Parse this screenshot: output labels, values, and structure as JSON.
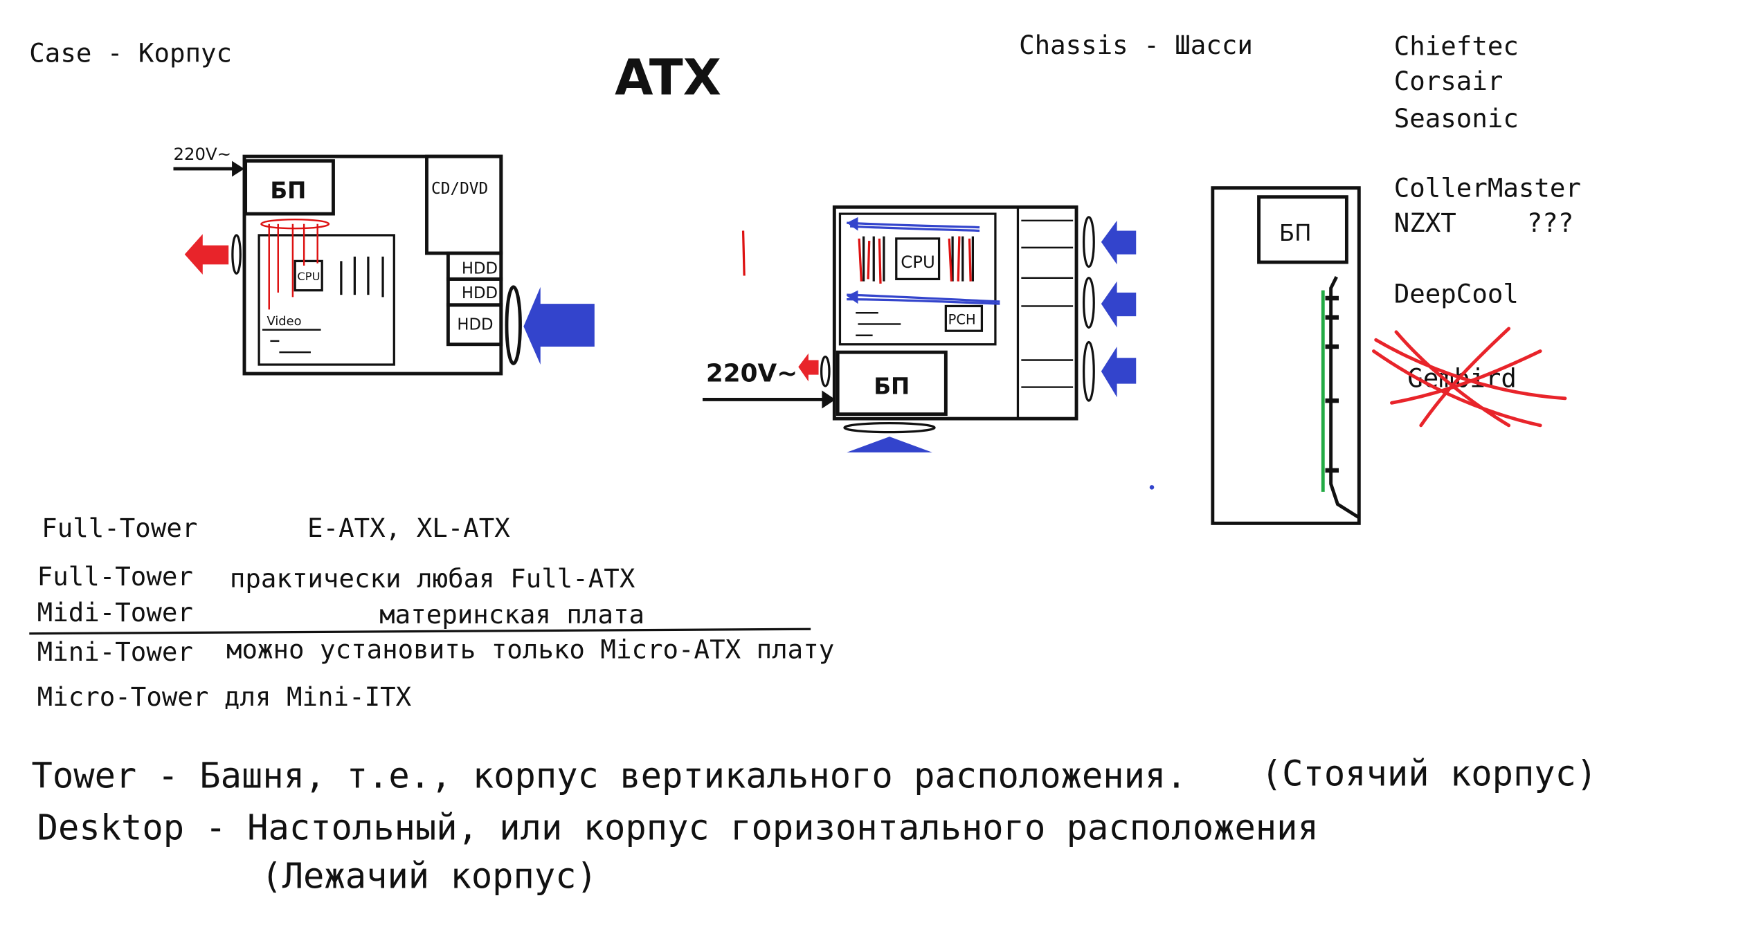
{
  "labels": {
    "case": "Case - Корпус",
    "title": "ATX",
    "chassis": "Chassis - Шасси"
  },
  "brands": {
    "items": [
      "Chieftec",
      "Corsair",
      "Seasonic",
      "CollerMaster",
      "NZXT",
      "DeepCool"
    ],
    "question": "???",
    "crossed": "Gembird"
  },
  "left_case": {
    "voltage": "220V~",
    "psu": "БП",
    "optical": "CD/DVD",
    "cpu": "CPU",
    "hdd1": "HDD",
    "hdd2": "HDD",
    "hdd3": "HDD",
    "video": "Video"
  },
  "mid_case": {
    "voltage": "220V~",
    "psu": "БП",
    "cpu": "CPU",
    "pch": "PCH"
  },
  "right_case": {
    "psu": "БП"
  },
  "sizes": {
    "row1_name": "Full-Tower",
    "row1_desc": "E-ATX, XL-ATX",
    "row2_name": "Full-Tower",
    "row2_desc": "практически любая Full-ATX",
    "row3_name": "Midi-Tower",
    "row3_desc": "материнская плата",
    "row4_name": "Mini-Tower",
    "row4_desc": "можно установить только Micro-ATX плату",
    "row5": "Micro-Tower для Mini-ITX"
  },
  "notes": {
    "tower": "Tower - Башня, т.е., корпус вертикального расположения.",
    "tower_paren": "(Стоячий корпус)",
    "desktop": "Desktop - Настольный, или корпус горизонтального расположения",
    "desktop_paren": "(Лежачий корпус)"
  },
  "colors": {
    "airflow_in": "#3344cc",
    "airflow_out": "#e8242a",
    "hot": "#dd1111",
    "cross": "#e8242a",
    "green_strip": "#22aa44",
    "ink": "#111111"
  }
}
